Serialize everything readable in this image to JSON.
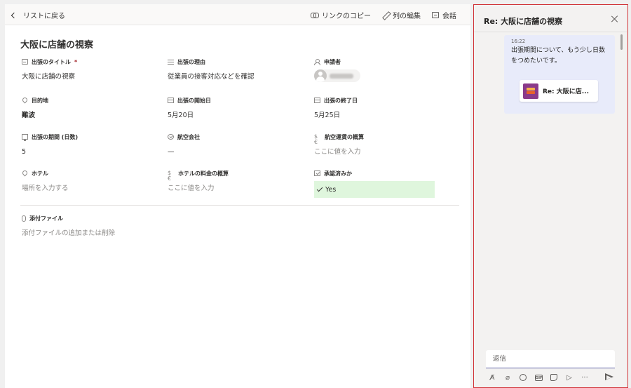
{
  "cmdbar": {
    "back_label": "リストに戻る",
    "copy_link": "リンクのコピー",
    "edit_columns": "列の編集",
    "conversation": "会話"
  },
  "form": {
    "title": "大阪に店舗の視察",
    "fields": {
      "trip_title": {
        "label": "出張のタイトル",
        "required": "*",
        "value": "大阪に店舗の視察",
        "icon": "text-icon"
      },
      "reason": {
        "label": "出張の理由",
        "value": "従業員の接客対応などを確認",
        "icon": "lines-icon"
      },
      "requester": {
        "label": "申請者",
        "icon": "person-icon"
      },
      "destination": {
        "label": "目的地",
        "value": "難波",
        "icon": "pin-icon"
      },
      "start_date": {
        "label": "出張の開始日",
        "value": "5月20日",
        "icon": "calendar-icon"
      },
      "end_date": {
        "label": "出張の終了日",
        "value": "5月25日",
        "icon": "calendar-icon"
      },
      "duration": {
        "label": "出張の期間 (日数)",
        "value": "5",
        "icon": "number-icon"
      },
      "airline": {
        "label": "航空会社",
        "value": "—",
        "icon": "choice-icon"
      },
      "airfare": {
        "label": "航空運賃の概算",
        "value": "ここに値を入力",
        "icon": "currency-icon"
      },
      "hotel": {
        "label": "ホテル",
        "value": "場所を入力する",
        "icon": "pin-icon"
      },
      "hotel_cost": {
        "label": "ホテルの料金の概算",
        "value": "ここに値を入力",
        "icon": "currency-icon"
      },
      "approved": {
        "label": "承認済みか",
        "value": "Yes",
        "highlight": "#dff6dd",
        "icon": "checkbox-icon"
      }
    },
    "attachments": {
      "label": "添付ファイル",
      "value": "添付ファイルの追加または削除",
      "icon": "paperclip-icon"
    }
  },
  "chat": {
    "title": "Re: 大阪に店舗の視察",
    "message": {
      "time": "16:22",
      "text": "出張期間について、もう少し日数をつめたいです。",
      "card_label": "Re: 大阪に店..."
    },
    "reply_placeholder": "返信",
    "border_color": "#d13438",
    "accent": "#6264a7"
  }
}
